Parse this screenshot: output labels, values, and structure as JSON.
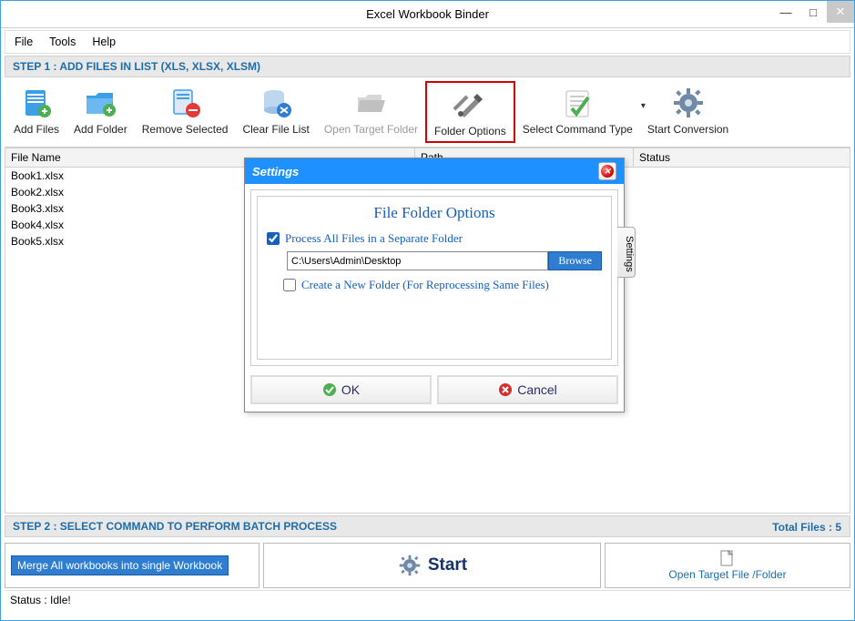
{
  "window": {
    "title": "Excel Workbook Binder"
  },
  "menu": {
    "file": "File",
    "tools": "Tools",
    "help": "Help"
  },
  "step1": {
    "label": "STEP 1 : ADD FILES IN LIST (XLS, XLSX, XLSM)"
  },
  "toolbar": {
    "add_files": "Add Files",
    "add_folder": "Add Folder",
    "remove_selected": "Remove Selected",
    "clear_list": "Clear File List",
    "open_target": "Open Target Folder",
    "folder_options": "Folder Options",
    "select_command": "Select Command Type",
    "start_conversion": "Start Conversion"
  },
  "table": {
    "headers": {
      "name": "File Name",
      "path": "Path",
      "status": "Status"
    },
    "rows": [
      {
        "name": "Book1.xlsx"
      },
      {
        "name": "Book2.xlsx"
      },
      {
        "name": "Book3.xlsx"
      },
      {
        "name": "Book4.xlsx"
      },
      {
        "name": "Book5.xlsx"
      }
    ]
  },
  "dialog": {
    "title": "Settings",
    "heading": "File Folder Options",
    "process_all_label": "Process All Files in a Separate Folder",
    "folder_path": "C:\\Users\\Admin\\Desktop",
    "browse_label": "Browse",
    "create_new_label": "Create a New Folder (For Reprocessing Same Files)",
    "settings_tab": "Settings",
    "ok_label": "OK",
    "cancel_label": "Cancel"
  },
  "totals": {
    "label": "Total Files : 5"
  },
  "step2": {
    "label": "STEP 2 : SELECT COMMAND TO PERFORM BATCH PROCESS"
  },
  "bottom": {
    "merge_label": "Merge All workbooks into single Workbook",
    "start_label": "Start",
    "open_target_label": "Open Target File /Folder"
  },
  "status": {
    "text": "Status  :  Idle!"
  }
}
